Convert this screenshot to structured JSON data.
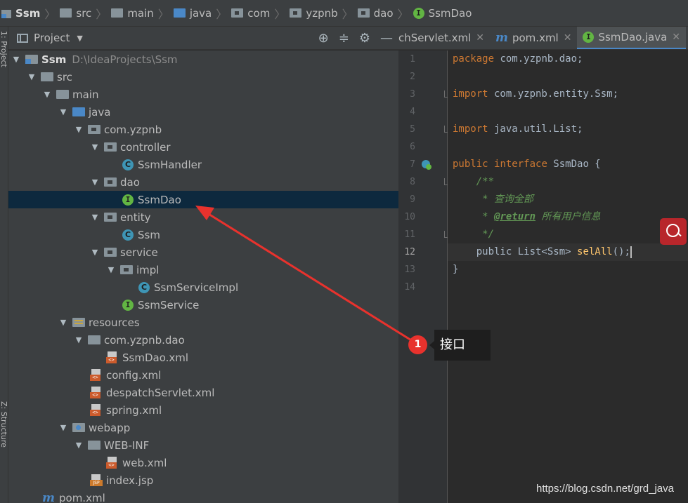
{
  "breadcrumb": {
    "items": [
      "Ssm",
      "src",
      "main",
      "java",
      "com",
      "yzpnb",
      "dao",
      "SsmDao"
    ]
  },
  "side_stripe": {
    "project_label": "1: Project",
    "structure_label": "Z: Structure"
  },
  "project_panel": {
    "title": "Project"
  },
  "tree": [
    {
      "label": "Ssm",
      "path": "D:\\IdeaProjects\\Ssm"
    },
    {
      "label": "src"
    },
    {
      "label": "main"
    },
    {
      "label": "java"
    },
    {
      "label": "com.yzpnb"
    },
    {
      "label": "controller"
    },
    {
      "label": "SsmHandler"
    },
    {
      "label": "dao"
    },
    {
      "label": "SsmDao"
    },
    {
      "label": "entity"
    },
    {
      "label": "Ssm"
    },
    {
      "label": "service"
    },
    {
      "label": "impl"
    },
    {
      "label": "SsmServiceImpl"
    },
    {
      "label": "SsmService"
    },
    {
      "label": "resources"
    },
    {
      "label": "com.yzpnb.dao"
    },
    {
      "label": "SsmDao.xml"
    },
    {
      "label": "config.xml"
    },
    {
      "label": "despatchServlet.xml"
    },
    {
      "label": "spring.xml"
    },
    {
      "label": "webapp"
    },
    {
      "label": "WEB-INF"
    },
    {
      "label": "web.xml"
    },
    {
      "label": "index.jsp"
    },
    {
      "label": "pom.xml"
    }
  ],
  "tabs": [
    {
      "label": "chServlet.xml"
    },
    {
      "label": "pom.xml"
    },
    {
      "label": "SsmDao.java"
    }
  ],
  "editor": {
    "line_numbers": [
      "1",
      "2",
      "3",
      "4",
      "5",
      "6",
      "7",
      "8",
      "9",
      "10",
      "11",
      "12",
      "13",
      "14"
    ],
    "l1_kw": "package",
    "l1_rest": " com.yzpnb.dao;",
    "l3_kw": "import",
    "l3_rest": " com.yzpnb.entity.Ssm;",
    "l5_kw": "import",
    "l5_rest": " java.util.List;",
    "l7_kw1": "public",
    "l7_kw2": "interface",
    "l7_rest": " SsmDao {",
    "l8": "    /**",
    "l9": "     * 查询全部",
    "l10_star": "     * ",
    "l10_tag": "@return",
    "l10_rest": " 所有用户信息",
    "l11": "     */",
    "l12_pre": "    public List<Ssm> ",
    "l12_fn": "selAll",
    "l12_rest": "();",
    "l13": "}"
  },
  "annotation": {
    "badge": "1",
    "callout": "接口"
  },
  "watermark": "https://blog.csdn.net/grd_java"
}
